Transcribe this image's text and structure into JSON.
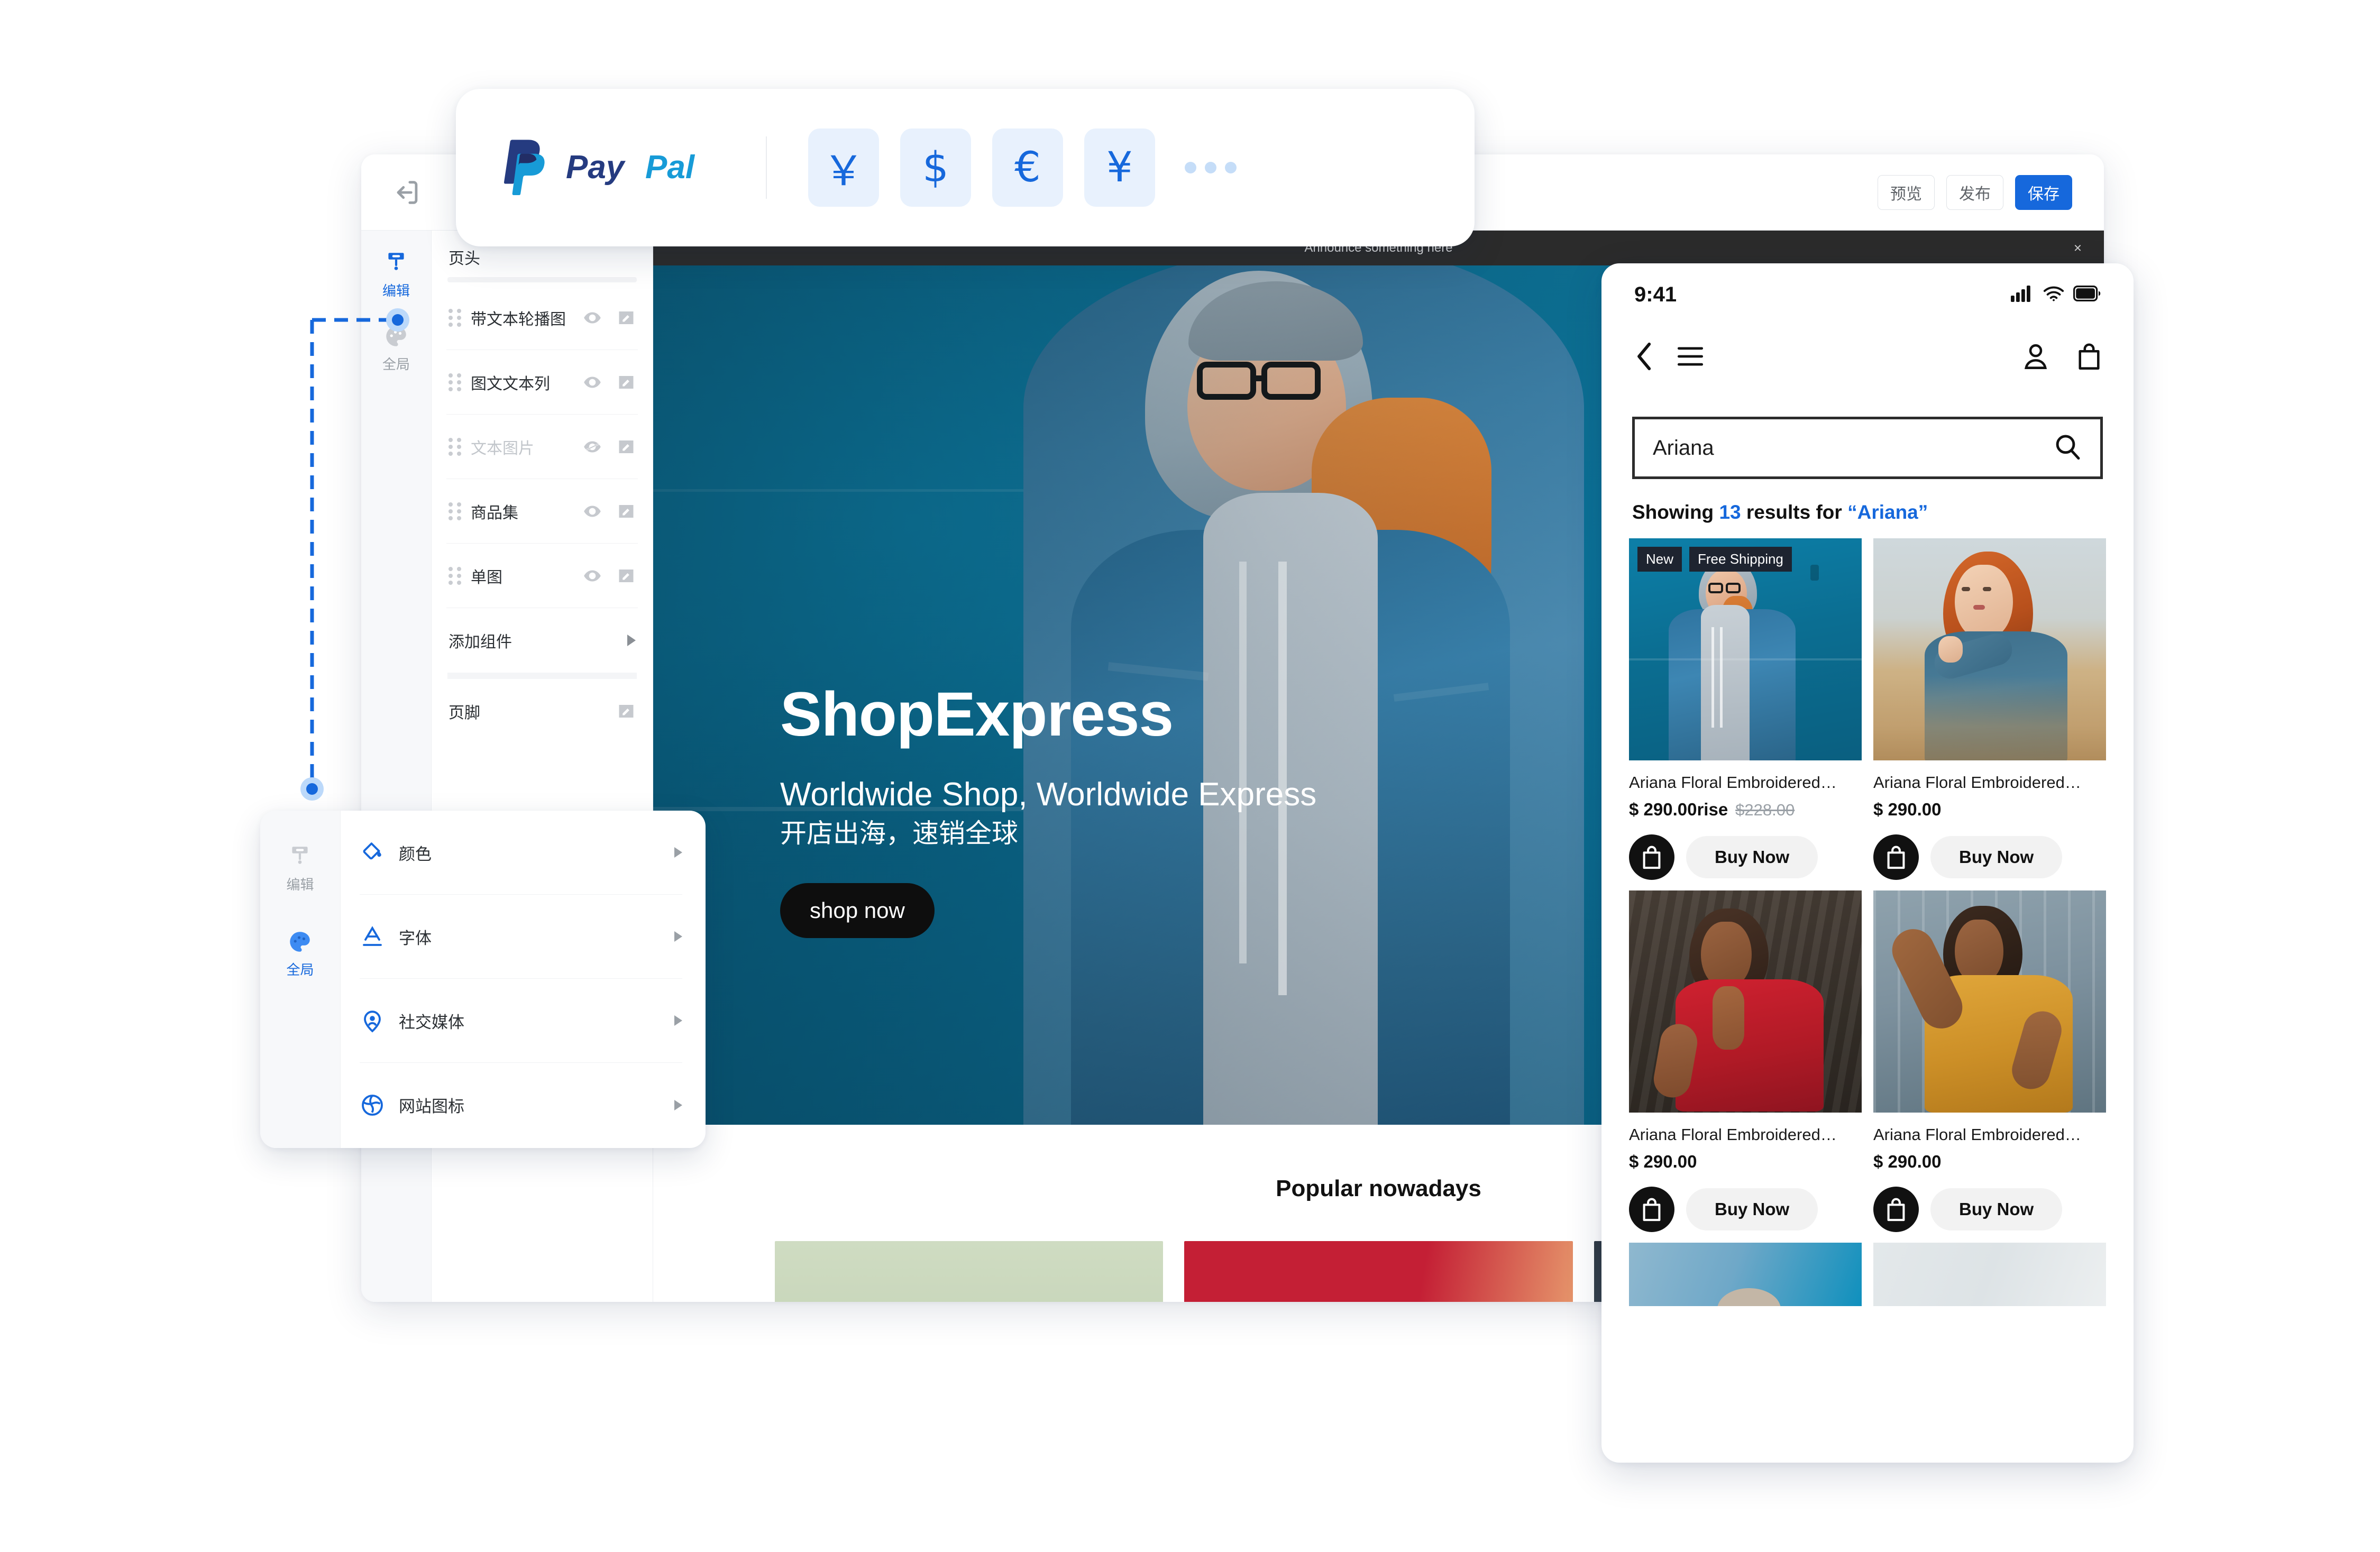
{
  "editor": {
    "topbar": {
      "exit_icon": "exit-icon",
      "preview_label": "预览",
      "publish_label": "发布",
      "save_label": "保存"
    },
    "rail": [
      {
        "label": "编辑",
        "icon": "brush-icon",
        "active": true
      },
      {
        "label": "全局",
        "icon": "palette-icon",
        "active": false
      }
    ],
    "panel": {
      "title": "页头",
      "components": [
        {
          "label": "带文本轮播图",
          "visible": true
        },
        {
          "label": "图文文本列",
          "visible": true
        },
        {
          "label": "文本图片",
          "visible": false
        },
        {
          "label": "商品集",
          "visible": true
        },
        {
          "label": "单图",
          "visible": true
        }
      ],
      "add_component_label": "添加组件",
      "footer_label": "页脚"
    },
    "canvas": {
      "announcement": "Announce something here",
      "announcement_close": "×",
      "hero": {
        "title": "ShopExpress",
        "subtitle_en": "Worldwide Shop, Worldwide Express",
        "subtitle_cn": "开店出海，速销全球",
        "cta_label": "shop now"
      },
      "popular_title": "Popular nowadays"
    }
  },
  "paypal_card": {
    "brand": "PayPal",
    "currencies": [
      {
        "symbol": "￥",
        "name": "cny-yuan"
      },
      {
        "symbol": "$",
        "name": "usd-dollar"
      },
      {
        "symbol": "€",
        "name": "eur-euro"
      },
      {
        "symbol": "¥",
        "name": "jpy-yen"
      }
    ],
    "more_label": "more-currencies"
  },
  "global_panel": {
    "rail": [
      {
        "label": "编辑",
        "icon": "brush-icon",
        "active": false
      },
      {
        "label": "全局",
        "icon": "palette-icon",
        "active": true
      }
    ],
    "items": [
      {
        "label": "颜色",
        "icon": "paint-bucket-icon"
      },
      {
        "label": "字体",
        "icon": "font-a-icon"
      },
      {
        "label": "社交媒体",
        "icon": "location-pin-icon"
      },
      {
        "label": "网站图标",
        "icon": "globe-icon"
      }
    ]
  },
  "phone": {
    "status": {
      "time": "9:41"
    },
    "search": {
      "value": "Ariana"
    },
    "results": {
      "prefix": "Showing ",
      "count": "13",
      "middle": " results for ",
      "query": "“Ariana”"
    },
    "products": [
      {
        "name": "Ariana Floral Embroidered…",
        "price": "$ 290.00rise",
        "old_price": "$228.00",
        "badges": [
          "New",
          "Free Shipping"
        ],
        "buy_label": "Buy Now"
      },
      {
        "name": "Ariana Floral Embroidered…",
        "price": "$ 290.00",
        "old_price": "",
        "badges": [],
        "buy_label": "Buy Now"
      },
      {
        "name": "Ariana Floral Embroidered…",
        "price": "$ 290.00",
        "old_price": "",
        "badges": [],
        "buy_label": "Buy Now"
      },
      {
        "name": "Ariana Floral Embroidered…",
        "price": "$ 290.00",
        "old_price": "",
        "badges": [],
        "buy_label": "Buy Now"
      }
    ]
  },
  "colors": {
    "accent_blue": "#1668dc",
    "paypal_navy": "#253B80",
    "paypal_blue": "#179BD7",
    "paypal_lightblue": "#009CDE",
    "chip_bg": "#e8f1fd",
    "dark": "#111111"
  }
}
